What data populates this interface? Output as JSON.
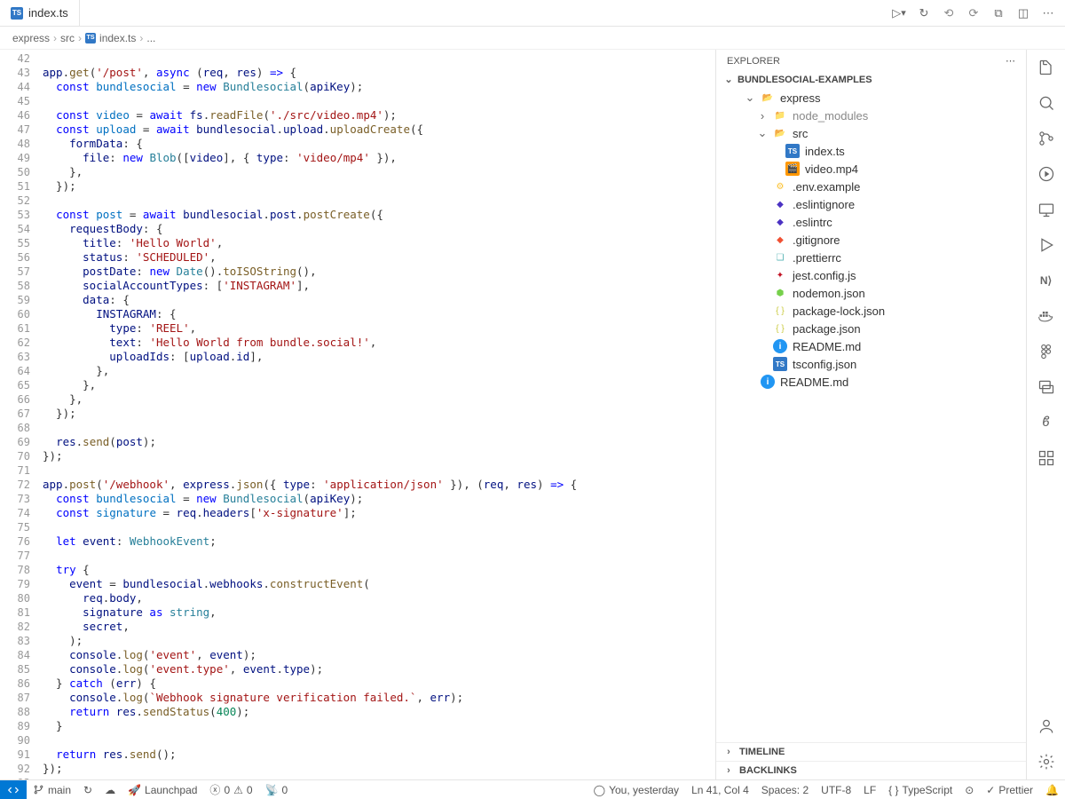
{
  "titlebar": {
    "tab_name": "index.ts",
    "tab_icon_text": "TS"
  },
  "breadcrumb": {
    "parts": [
      "express",
      "src",
      "index.ts",
      "..."
    ],
    "icon_text": "TS"
  },
  "gutter": {
    "start": 42,
    "end": 93
  },
  "code_lines": [
    "",
    "<span class='tok-var'>app</span>.<span class='tok-fn'>get</span>(<span class='tok-str'>'/post'</span>, <span class='tok-kw'>async</span> (<span class='tok-var'>req</span>, <span class='tok-var'>res</span>) <span class='tok-kw'>=&gt;</span> {",
    "  <span class='tok-kw'>const</span> <span class='tok-const'>bundlesocial</span> = <span class='tok-kw'>new</span> <span class='tok-type'>Bundlesocial</span>(<span class='tok-var'>apiKey</span>);",
    "",
    "  <span class='tok-kw'>const</span> <span class='tok-const'>video</span> = <span class='tok-kw'>await</span> <span class='tok-var'>fs</span>.<span class='tok-fn'>readFile</span>(<span class='tok-str'>'./src/video.mp4'</span>);",
    "  <span class='tok-kw'>const</span> <span class='tok-const'>upload</span> = <span class='tok-kw'>await</span> <span class='tok-var'>bundlesocial</span>.<span class='tok-var'>upload</span>.<span class='tok-fn'>uploadCreate</span>({",
    "    <span class='tok-prop'>formData</span>: {",
    "      <span class='tok-prop'>file</span>: <span class='tok-kw'>new</span> <span class='tok-type'>Blob</span>([<span class='tok-var'>video</span>], { <span class='tok-prop'>type</span>: <span class='tok-str'>'video/mp4'</span> }),",
    "    },",
    "  });",
    "",
    "  <span class='tok-kw'>const</span> <span class='tok-const'>post</span> = <span class='tok-kw'>await</span> <span class='tok-var'>bundlesocial</span>.<span class='tok-var'>post</span>.<span class='tok-fn'>postCreate</span>({",
    "    <span class='tok-prop'>requestBody</span>: {",
    "      <span class='tok-prop'>title</span>: <span class='tok-str'>'Hello World'</span>,",
    "      <span class='tok-prop'>status</span>: <span class='tok-str'>'SCHEDULED'</span>,",
    "      <span class='tok-prop'>postDate</span>: <span class='tok-kw'>new</span> <span class='tok-type'>Date</span>().<span class='tok-fn'>toISOString</span>(),",
    "      <span class='tok-prop'>socialAccountTypes</span>: [<span class='tok-str'>'INSTAGRAM'</span>],",
    "      <span class='tok-prop'>data</span>: {",
    "        <span class='tok-prop'>INSTAGRAM</span>: {",
    "          <span class='tok-prop'>type</span>: <span class='tok-str'>'REEL'</span>,",
    "          <span class='tok-prop'>text</span>: <span class='tok-str'>'Hello World from bundle.social!'</span>,",
    "          <span class='tok-prop'>uploadIds</span>: [<span class='tok-var'>upload</span>.<span class='tok-var'>id</span>],",
    "        },",
    "      },",
    "    },",
    "  });",
    "",
    "  <span class='tok-var'>res</span>.<span class='tok-fn'>send</span>(<span class='tok-var'>post</span>);",
    "});",
    "",
    "<span class='tok-var'>app</span>.<span class='tok-fn'>post</span>(<span class='tok-str'>'/webhook'</span>, <span class='tok-var'>express</span>.<span class='tok-fn'>json</span>({ <span class='tok-prop'>type</span>: <span class='tok-str'>'application/json'</span> }), (<span class='tok-var'>req</span>, <span class='tok-var'>res</span>) <span class='tok-kw'>=&gt;</span> {",
    "  <span class='tok-kw'>const</span> <span class='tok-const'>bundlesocial</span> = <span class='tok-kw'>new</span> <span class='tok-type'>Bundlesocial</span>(<span class='tok-var'>apiKey</span>);",
    "  <span class='tok-kw'>const</span> <span class='tok-const'>signature</span> = <span class='tok-var'>req</span>.<span class='tok-var'>headers</span>[<span class='tok-str'>'x-signature'</span>];",
    "",
    "  <span class='tok-kw'>let</span> <span class='tok-var'>event</span>: <span class='tok-type'>WebhookEvent</span>;",
    "",
    "  <span class='tok-kw'>try</span> {",
    "    <span class='tok-var'>event</span> = <span class='tok-var'>bundlesocial</span>.<span class='tok-var'>webhooks</span>.<span class='tok-fn'>constructEvent</span>(",
    "      <span class='tok-var'>req</span>.<span class='tok-var'>body</span>,",
    "      <span class='tok-var'>signature</span> <span class='tok-kw'>as</span> <span class='tok-type'>string</span>,",
    "      <span class='tok-var'>secret</span>,",
    "    );",
    "    <span class='tok-var'>console</span>.<span class='tok-fn'>log</span>(<span class='tok-str'>'event'</span>, <span class='tok-var'>event</span>);",
    "    <span class='tok-var'>console</span>.<span class='tok-fn'>log</span>(<span class='tok-str'>'event.type'</span>, <span class='tok-var'>event</span>.<span class='tok-var'>type</span>);",
    "  } <span class='tok-kw'>catch</span> (<span class='tok-var'>err</span>) {",
    "    <span class='tok-var'>console</span>.<span class='tok-fn'>log</span>(<span class='tok-str'>`Webhook signature verification failed.`</span>, <span class='tok-var'>err</span>);",
    "    <span class='tok-kw'>return</span> <span class='tok-var'>res</span>.<span class='tok-fn'>sendStatus</span>(<span class='tok-num'>400</span>);",
    "  }",
    "",
    "  <span class='tok-kw'>return</span> <span class='tok-var'>res</span>.<span class='tok-fn'>send</span>();",
    "});",
    ""
  ],
  "explorer": {
    "title": "EXPLORER",
    "workspace": "BUNDLESOCIAL-EXAMPLES",
    "tree": [
      {
        "depth": 0,
        "name": "express",
        "type": "folder-open",
        "chev": "down"
      },
      {
        "depth": 1,
        "name": "node_modules",
        "type": "folder-green",
        "chev": "right",
        "muted": true
      },
      {
        "depth": 1,
        "name": "src",
        "type": "folder-src",
        "chev": "down"
      },
      {
        "depth": 2,
        "name": "index.ts",
        "type": "ts"
      },
      {
        "depth": 2,
        "name": "video.mp4",
        "type": "video"
      },
      {
        "depth": 1,
        "name": ".env.example",
        "type": "env"
      },
      {
        "depth": 1,
        "name": ".eslintignore",
        "type": "eslint"
      },
      {
        "depth": 1,
        "name": ".eslintrc",
        "type": "eslint"
      },
      {
        "depth": 1,
        "name": ".gitignore",
        "type": "git"
      },
      {
        "depth": 1,
        "name": ".prettierrc",
        "type": "prettier"
      },
      {
        "depth": 1,
        "name": "jest.config.js",
        "type": "jest"
      },
      {
        "depth": 1,
        "name": "nodemon.json",
        "type": "nodemon"
      },
      {
        "depth": 1,
        "name": "package-lock.json",
        "type": "json"
      },
      {
        "depth": 1,
        "name": "package.json",
        "type": "json"
      },
      {
        "depth": 1,
        "name": "README.md",
        "type": "readme"
      },
      {
        "depth": 1,
        "name": "tsconfig.json",
        "type": "ts"
      },
      {
        "depth": 0,
        "name": "README.md",
        "type": "readme"
      }
    ],
    "panels": [
      "TIMELINE",
      "BACKLINKS"
    ]
  },
  "statusbar": {
    "branch": "main",
    "launchpad": "Launchpad",
    "errors": "0",
    "warnings": "0",
    "ports": "0",
    "blame": "You, yesterday",
    "cursor": "Ln 41, Col 4",
    "spaces": "Spaces: 2",
    "encoding": "UTF-8",
    "eol": "LF",
    "lang": "TypeScript",
    "prettier": "Prettier"
  }
}
